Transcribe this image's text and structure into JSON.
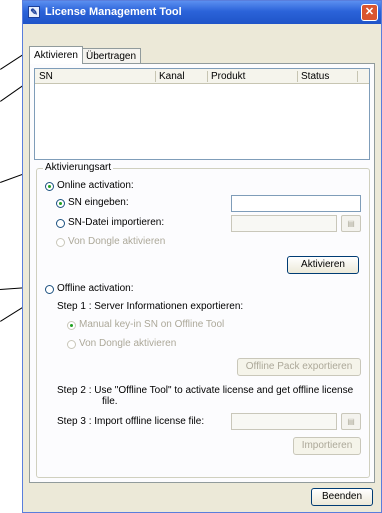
{
  "window": {
    "title": "License Management Tool",
    "close_label": "✕"
  },
  "tabs": [
    {
      "label": "Aktivieren"
    },
    {
      "label": "Übertragen"
    }
  ],
  "license_list": {
    "columns": [
      "SN",
      "Kanal",
      "Produkt",
      "Status"
    ]
  },
  "activation_group": {
    "legend": "Aktivierungsart",
    "online": {
      "label": "Online activation:",
      "sn_enter_label": "SN eingeben:",
      "sn_enter_value": "",
      "sn_file_label": "SN-Datei importieren:",
      "sn_file_value": "",
      "dongle_label": "Von Dongle aktivieren",
      "activate_button": "Aktivieren"
    },
    "offline": {
      "label": "Offline activation:",
      "step1": "Step 1 : Server Informationen exportieren:",
      "manual_label": "Manual key-in SN on Offline Tool",
      "dongle_label": "Von Dongle aktivieren",
      "export_button": "Offline Pack exportieren",
      "step2_line1": "Step 2 : Use \"Offline Tool\" to activate license and get offline license",
      "step2_line2": "file.",
      "step3": "Step 3 : Import offline license file:",
      "import_value": "",
      "import_button": "Importieren"
    }
  },
  "footer": {
    "exit_button": "Beenden"
  },
  "icons": {
    "browse": "folder-browse-icon",
    "app": "license-app-icon"
  }
}
